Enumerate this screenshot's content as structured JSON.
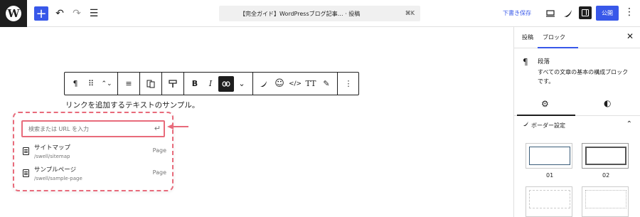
{
  "toolbar": {
    "add_label": "+",
    "undo": "↶",
    "redo": "↷",
    "list_view": "☰",
    "doc_title": "【完全ガイド】WordPressブログ記事… · 投稿",
    "doc_shortcut": "⌘K",
    "draft_label": "下書き保存",
    "publish_label": "公開",
    "more": "⋮"
  },
  "block_toolbar": {
    "paragraph": "¶",
    "drag": "⠿",
    "move": "⌃⌄",
    "align": "≡",
    "bold": "B",
    "italic": "I",
    "link": "⊘",
    "chevron": "⌄",
    "emoji": "☺",
    "code": "</>",
    "font": "TT",
    "highlight": "✎",
    "more": "⋮"
  },
  "content": {
    "paragraph_text": "リンクを追加するテキストのサンプル。"
  },
  "link_popover": {
    "search_placeholder": "検索または URL を入力",
    "enter_icon": "↵",
    "results": [
      {
        "title": "サイトマップ",
        "url": "/swell/sitemap",
        "type": "Page"
      },
      {
        "title": "サンプルページ",
        "url": "/swell/sample-page",
        "type": "Page"
      }
    ]
  },
  "sidebar": {
    "tab_post": "投稿",
    "tab_block": "ブロック",
    "close": "✕",
    "block_icon": "¶",
    "block_name": "段落",
    "block_desc": "すべての文章の基本の構成ブロックです。",
    "settings_icon": "⚙",
    "styles_icon": "◐",
    "border_title": "ボーダー設定",
    "border_chevron": "⌃",
    "swatches": [
      {
        "label": "01"
      },
      {
        "label": "02"
      }
    ]
  },
  "colors": {
    "accent": "#3858e9",
    "highlight_pink": "#e86b7b",
    "dark": "#1e1e1e"
  }
}
